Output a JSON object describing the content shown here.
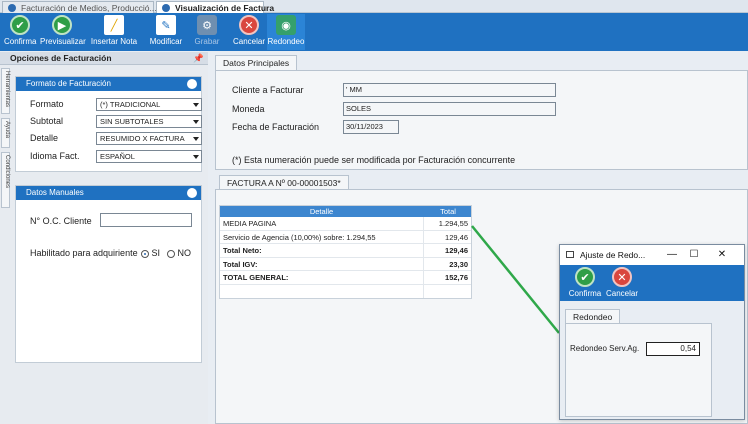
{
  "tabs": [
    {
      "label": "Facturación de Medios, Producció..."
    },
    {
      "label": "Visualización de Factura"
    }
  ],
  "ribbon": {
    "buttons": [
      {
        "label": "Confirma",
        "icon": "check-icon"
      },
      {
        "label": "Previsualizar",
        "icon": "play-icon"
      },
      {
        "label": "Insertar Nota",
        "icon": "chart-icon"
      },
      {
        "label": "Modificar",
        "icon": "edit-document-icon"
      },
      {
        "label": "Grabar",
        "icon": "gear-icon"
      },
      {
        "label": "Cancelar",
        "icon": "close-icon"
      },
      {
        "label": "Redondeo",
        "icon": "round-icon"
      }
    ]
  },
  "leftpanel": {
    "title": "Opciones de Facturación",
    "pin": "ᵖ",
    "vtabs": [
      "Herramientas",
      "Ayuda",
      "Condiciones"
    ],
    "formato_group": {
      "title": "Formato de Facturación",
      "fields": [
        {
          "label": "Formato",
          "value": "(*) TRADICIONAL"
        },
        {
          "label": "Subtotal",
          "value": "SIN SUBTOTALES"
        },
        {
          "label": "Detalle",
          "value": "RESUMIDO X FACTURA"
        },
        {
          "label": "Idioma Fact.",
          "value": "ESPAÑOL"
        }
      ]
    },
    "manual_group": {
      "title": "Datos Manuales",
      "oc_label": "N° O.C. Cliente",
      "oc_value": "",
      "adq_label": "Habilitado para adquiriente",
      "si": "SI",
      "no": "NO"
    }
  },
  "datos": {
    "tab": "Datos Principales",
    "cliente_label": "Cliente a Facturar",
    "cliente_value": "' MM",
    "moneda_label": "Moneda",
    "moneda_value": "SOLES",
    "fecha_label": "Fecha de Facturación",
    "fecha_value": "30/11/2023",
    "note": "(*) Esta numeración puede ser modificada por Facturación concurrente"
  },
  "factura": {
    "tab": "FACTURA A Nº 00-00001503*",
    "columns": [
      "Detalle",
      "Total"
    ],
    "rows": [
      {
        "detalle": "MEDIA PAGINA",
        "total": "1.294,55",
        "bold": false
      },
      {
        "detalle": "Servicio de Agencia (10,00%) sobre: 1.294,55",
        "total": "129,46",
        "bold": false
      },
      {
        "detalle": "Total Neto:",
        "total": "129,46",
        "bold": true
      },
      {
        "detalle": "Total IGV:",
        "total": "23,30",
        "bold": true
      },
      {
        "detalle": "TOTAL GENERAL:",
        "total": "152,76",
        "bold": true
      }
    ]
  },
  "dialog": {
    "title": "Ajuste de Redo...",
    "confirma": "Confirma",
    "cancelar": "Cancelar",
    "tab": "Redondeo",
    "field_label": "Redondeo Serv.Ag.",
    "field_value": "0,54"
  },
  "colors": {
    "accent": "#1f71c1",
    "annotation": "#2fa84a"
  }
}
